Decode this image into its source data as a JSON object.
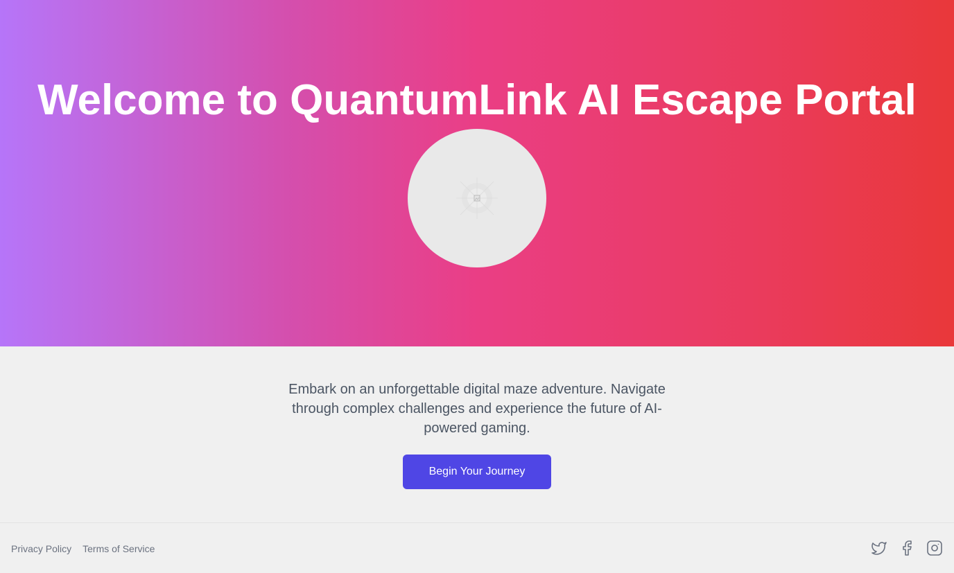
{
  "hero": {
    "title": "Welcome to QuantumLink AI Escape Portal",
    "image_icon": "image-placeholder-icon",
    "gradient_start": "#b675f9",
    "gradient_end": "#e9383a"
  },
  "main": {
    "tagline": "Embark on an unforgettable digital maze adventure. Navigate through complex challenges and experience the future of AI-powered gaming.",
    "cta_label": "Begin Your Journey",
    "cta_color": "#4f46e5"
  },
  "footer": {
    "links": [
      "Privacy Policy",
      "Terms of Service"
    ],
    "social_icons": [
      "twitter-icon",
      "facebook-icon",
      "instagram-icon"
    ]
  }
}
